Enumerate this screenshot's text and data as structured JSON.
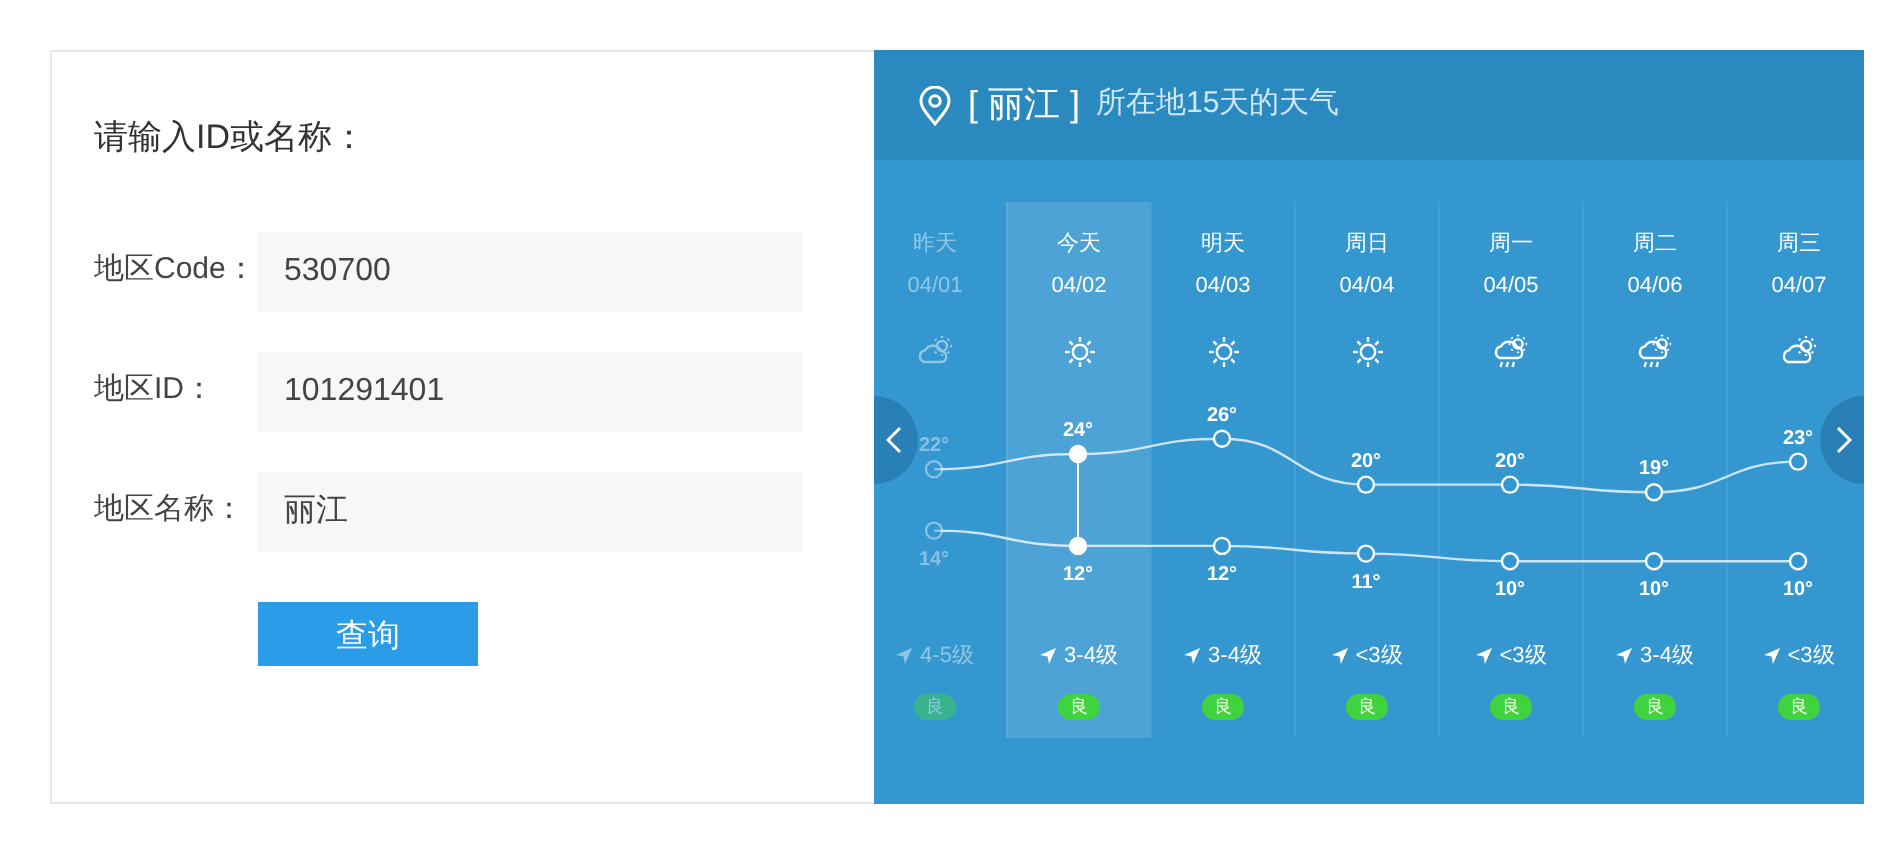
{
  "query_form": {
    "title": "请输入ID或名称：",
    "fields": [
      {
        "label": "地区Code：",
        "value": "530700"
      },
      {
        "label": "地区ID：",
        "value": "101291401"
      },
      {
        "label": "地区名称：",
        "value": "丽江"
      }
    ],
    "button": "查询"
  },
  "forecast": {
    "city": "[ 丽江 ]",
    "subtitle": "所在地15天的天气",
    "days": [
      {
        "label": "昨天",
        "date": "04/01",
        "kind": "partly-cloudy",
        "wind": "4-5级",
        "aqi": "良",
        "past": true,
        "selected": false
      },
      {
        "label": "今天",
        "date": "04/02",
        "kind": "sunny",
        "wind": "3-4级",
        "aqi": "良",
        "past": false,
        "selected": true
      },
      {
        "label": "明天",
        "date": "04/03",
        "kind": "sunny",
        "wind": "3-4级",
        "aqi": "良",
        "past": false,
        "selected": false
      },
      {
        "label": "周日",
        "date": "04/04",
        "kind": "sunny",
        "wind": "<3级",
        "aqi": "良",
        "past": false,
        "selected": false
      },
      {
        "label": "周一",
        "date": "04/05",
        "kind": "rain",
        "wind": "<3级",
        "aqi": "良",
        "past": false,
        "selected": false
      },
      {
        "label": "周二",
        "date": "04/06",
        "kind": "rain",
        "wind": "3-4级",
        "aqi": "良",
        "past": false,
        "selected": false
      },
      {
        "label": "周三",
        "date": "04/07",
        "kind": "partly-cloudy",
        "wind": "<3级",
        "aqi": "良",
        "past": false,
        "selected": false
      }
    ],
    "chart_data": {
      "type": "line",
      "series": [
        {
          "color": "#ffffff",
          "marker": "circle",
          "values": [
            22,
            24,
            26,
            20,
            20,
            19,
            23
          ],
          "value_labels": [
            "22°",
            "24°",
            "26°",
            "20°",
            "20°",
            "19°",
            "23°"
          ]
        },
        {
          "color": "#ffffff",
          "marker": "circle",
          "values": [
            14,
            12,
            12,
            11,
            10,
            10,
            10
          ],
          "value_labels": [
            "14°",
            "12°",
            "12°",
            "11°",
            "10°",
            "10°",
            "10°"
          ]
        }
      ]
    }
  }
}
